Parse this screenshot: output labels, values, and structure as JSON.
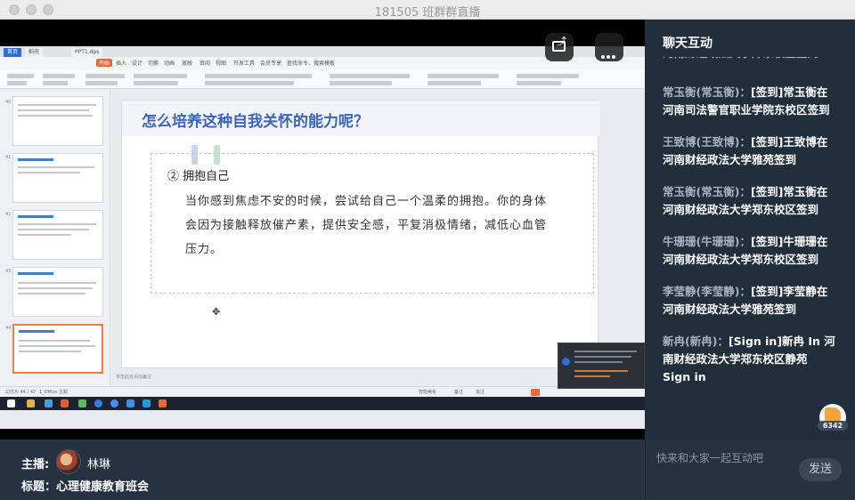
{
  "window": {
    "title": "181505 班群群直播"
  },
  "wps": {
    "tabs": [
      "首页",
      "稻壳",
      "PPT1.dps"
    ],
    "menu": [
      "开始",
      "插入",
      "设计",
      "切换",
      "动画",
      "放映",
      "审阅",
      "视图",
      "开发工具",
      "会员专享",
      "查找命令、搜索模板"
    ],
    "active_menu": "开始",
    "statusbar_left": "幻灯片 44 / 47",
    "statusbar_theme": "1_Office 主题",
    "notes_placeholder": "单击此处添加备注",
    "statusbar_right": [
      "智能美化",
      "备注",
      "批注"
    ]
  },
  "slide": {
    "title": "怎么培养这种自我关怀的能力呢？",
    "subheading": "② 拥抱自己",
    "body": "当你感到焦虑不安的时候，尝试给自己一个温柔的拥抱。你的身体会因为接触释放催产素，提供安全感，平复消极情绪，减低心血管压力。"
  },
  "thumbnails": {
    "numbers": [
      "40",
      "41",
      "42",
      "43",
      "44"
    ]
  },
  "chat": {
    "title": "聊天互动",
    "messages": [
      {
        "who": "常玉衡(常玉衡)：",
        "text": "[签到]常玉衡在河南司法警官职业学院东校区签到"
      },
      {
        "who": "王致博(王致博)：",
        "text": "[签到]王致博在河南财经政法大学雅苑签到"
      },
      {
        "who": "常玉衡(常玉衡)：",
        "text": "[签到]常玉衡在河南财经政法大学郑东校区签到"
      },
      {
        "who": "牛珊珊(牛珊珊)：",
        "text": "[签到]牛珊珊在河南财经政法大学郑东校区签到"
      },
      {
        "who": "李莹静(李莹静)：",
        "text": "[签到]李莹静在河南财经政法大学雅苑签到"
      },
      {
        "who": "新冉(新冉)：",
        "text": "[Sign in]新冉 In 河南财经政法大学郑东校区静苑 Sign in"
      }
    ],
    "like_count": "6342",
    "input_placeholder": "快来和大家一起互动吧",
    "send_label": "发送"
  },
  "host": {
    "label": "主播:",
    "name": "林琳",
    "subject": "标题：心理健康教育班会"
  },
  "icons": [
    "screencast-icon",
    "more-icon",
    "like-icon",
    "avatar"
  ],
  "colors": {
    "chat_bg": "#212e3c",
    "accent_title": "#3c63c2",
    "like": "#f3a53c",
    "wps_accent": "#e86a3b"
  }
}
